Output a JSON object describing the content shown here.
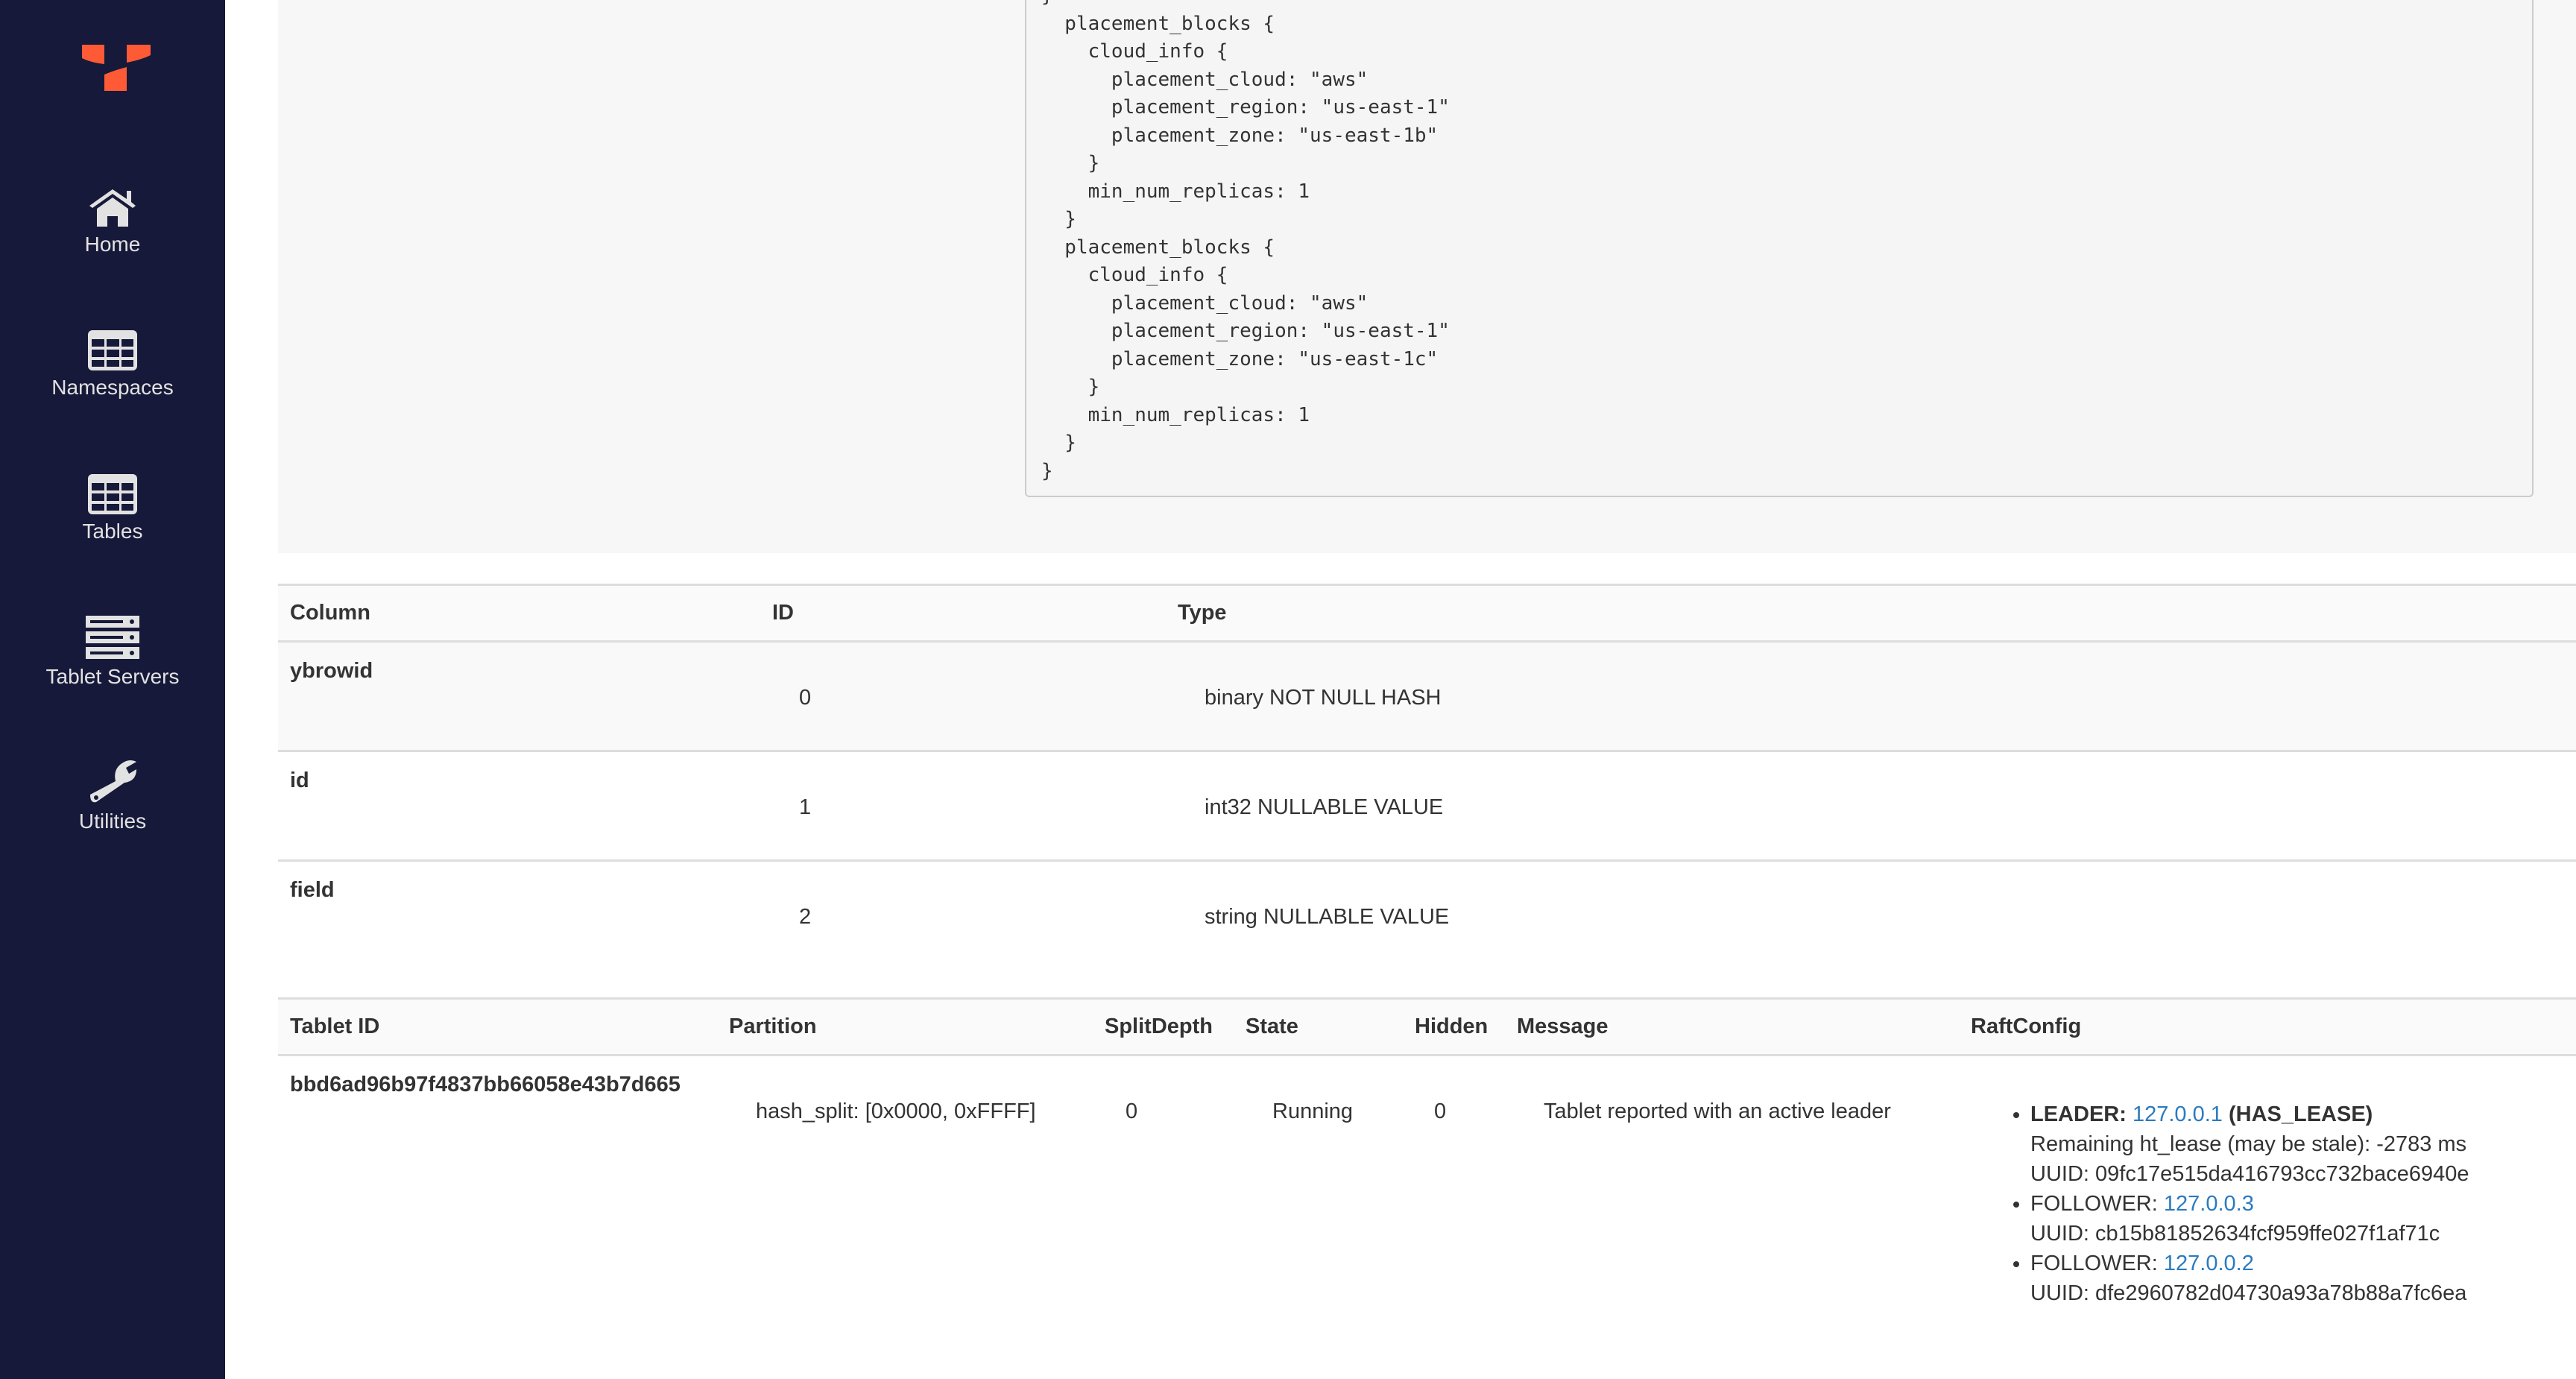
{
  "brand": {
    "logo_color": "#ff5a36",
    "sidebar_bg": "#161939",
    "link_color": "#2a7ac0"
  },
  "sidebar": {
    "items": [
      {
        "label": "Home",
        "icon": "home-icon"
      },
      {
        "label": "Namespaces",
        "icon": "table-grid-icon"
      },
      {
        "label": "Tables",
        "icon": "table-grid-icon"
      },
      {
        "label": "Tablet Servers",
        "icon": "server-icon"
      },
      {
        "label": "Utilities",
        "icon": "wrench-icon"
      }
    ]
  },
  "replication_info": {
    "code": "}\n  placement_blocks {\n    cloud_info {\n      placement_cloud: \"aws\"\n      placement_region: \"us-east-1\"\n      placement_zone: \"us-east-1b\"\n    }\n    min_num_replicas: 1\n  }\n  placement_blocks {\n    cloud_info {\n      placement_cloud: \"aws\"\n      placement_region: \"us-east-1\"\n      placement_zone: \"us-east-1c\"\n    }\n    min_num_replicas: 1\n  }\n}"
  },
  "columns_table": {
    "headers": [
      "Column",
      "ID",
      "Type"
    ],
    "rows": [
      {
        "column": "ybrowid",
        "id": "0",
        "type": "binary NOT NULL HASH"
      },
      {
        "column": "id",
        "id": "1",
        "type": "int32 NULLABLE VALUE"
      },
      {
        "column": "field",
        "id": "2",
        "type": "string NULLABLE VALUE"
      }
    ]
  },
  "tablets_table": {
    "headers": [
      "Tablet ID",
      "Partition",
      "SplitDepth",
      "State",
      "Hidden",
      "Message",
      "RaftConfig"
    ],
    "rows": [
      {
        "tablet_id": "bbd6ad96b97f4837bb66058e43b7d665",
        "partition": "hash_split: [0x0000, 0xFFFF]",
        "split_depth": "0",
        "state": "Running",
        "hidden": "0",
        "message": "Tablet reported with an active leader",
        "raft": {
          "leader_label": "LEADER:",
          "leader_host": "127.0.0.1",
          "leader_lease": "(HAS_LEASE)",
          "leader_remaining": "Remaining ht_lease (may be stale): -2783 ms",
          "leader_uuid": "UUID: 09fc17e515da416793cc732bace6940e",
          "followers": [
            {
              "label": "FOLLOWER:",
              "host": "127.0.0.3",
              "uuid": "UUID: cb15b81852634fcf959ffe027f1af71c"
            },
            {
              "label": "FOLLOWER:",
              "host": "127.0.0.2",
              "uuid": "UUID: dfe2960782d04730a93a78b88a7fc6ea"
            }
          ]
        }
      }
    ]
  }
}
